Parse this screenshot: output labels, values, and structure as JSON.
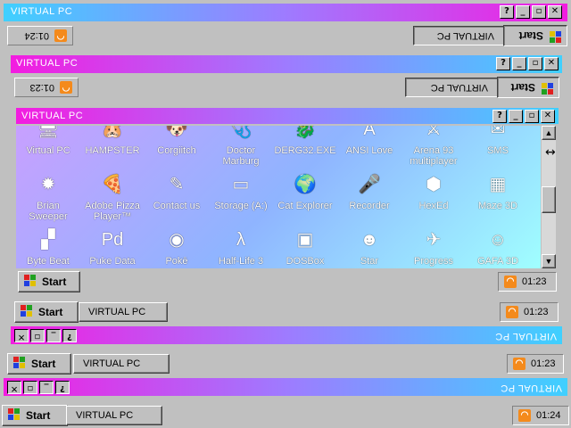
{
  "window_title": "VIRTUAL PC",
  "taskbar": {
    "start_label": "Start",
    "task_label": "VIRTUAL PC",
    "clock_main": "01:23",
    "clock_bottom": "01:24",
    "clock_flipped_top": "01:24",
    "clock_flipped_2": "01:23"
  },
  "title_buttons": {
    "help": "?",
    "minimize": "_",
    "restore": "▫",
    "close": "✕"
  },
  "desktop_icons": [
    {
      "label": "Virtual PC",
      "icon": "computer-icon"
    },
    {
      "label": "HAMPSTER",
      "icon": "hamster-icon"
    },
    {
      "label": "Corgiitch",
      "icon": "dog-icon"
    },
    {
      "label": "Doctor Marburg",
      "icon": "doctor-icon"
    },
    {
      "label": "DERG32.EXE",
      "icon": "dragon-exe-icon"
    },
    {
      "label": "ANSI Love",
      "icon": "ansi-icon"
    },
    {
      "label": "Arena 93 multiplayer",
      "icon": "arena-icon"
    },
    {
      "label": "SMS",
      "icon": "sms-icon"
    },
    {
      "label": "Brian Sweeper",
      "icon": "mine-icon"
    },
    {
      "label": "Adobe Pizza Player™",
      "icon": "pizza-icon"
    },
    {
      "label": "Contact us",
      "icon": "contact-icon"
    },
    {
      "label": "Storage (A:)",
      "icon": "floppy-drive-icon"
    },
    {
      "label": "Cat Explorer",
      "icon": "globe-icon"
    },
    {
      "label": "Recorder",
      "icon": "microphone-icon"
    },
    {
      "label": "HexEd",
      "icon": "hex-icon"
    },
    {
      "label": "Maze 3D",
      "icon": "maze-icon"
    },
    {
      "label": "Byte Beat",
      "icon": "bytebeat-icon"
    },
    {
      "label": "Puke Data",
      "icon": "pd-icon"
    },
    {
      "label": "Pokē",
      "icon": "pokeball-icon"
    },
    {
      "label": "Half-Life 3",
      "icon": "lambda-icon"
    },
    {
      "label": "DOSBox",
      "icon": "dosbox-icon"
    },
    {
      "label": "Star",
      "icon": "yoda-icon"
    },
    {
      "label": "Progress",
      "icon": "progress-icon"
    },
    {
      "label": "GAFA 3D",
      "icon": "face-icon"
    }
  ],
  "colors": {
    "title_pink": "#f31ce0",
    "title_cyan": "#3fd0ff",
    "face": "#c0c0c0"
  }
}
